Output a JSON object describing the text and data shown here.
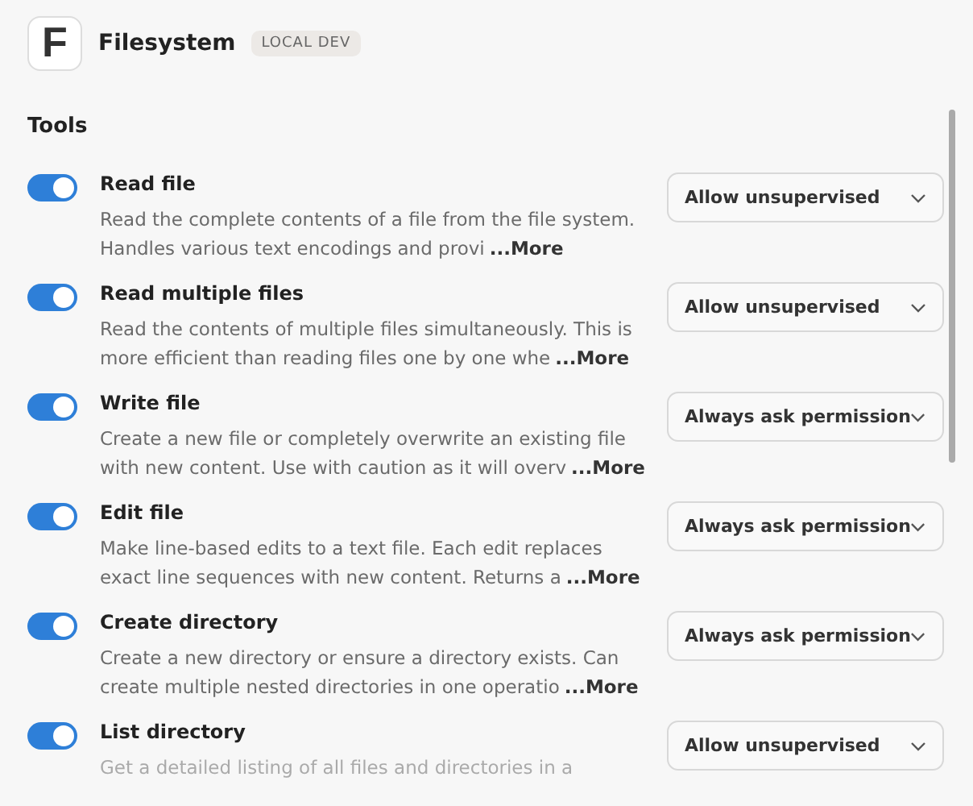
{
  "header": {
    "logo_letter": "F",
    "title": "Filesystem",
    "badge": "LOCAL DEV"
  },
  "section_title": "Tools",
  "tools": [
    {
      "name": "Read file",
      "on": true,
      "description": "Read the complete contents of a file from the file system. Handles various text encodings and provi",
      "more": "...More",
      "permission": "Allow unsupervised"
    },
    {
      "name": "Read multiple files",
      "on": true,
      "description": "Read the contents of multiple files simultaneously. This is more efficient than reading files one by one whe",
      "more": "...More",
      "permission": "Allow unsupervised"
    },
    {
      "name": "Write file",
      "on": true,
      "description": "Create a new file or completely overwrite an existing file with new content. Use with caution as it will overv",
      "more": "...More",
      "permission": "Always ask permission"
    },
    {
      "name": "Edit file",
      "on": true,
      "description": "Make line-based edits to a text file. Each edit replaces exact line sequences with new content. Returns a",
      "more": "...More",
      "permission": "Always ask permission"
    },
    {
      "name": "Create directory",
      "on": true,
      "description": "Create a new directory or ensure a directory exists. Can create multiple nested directories in one operatio",
      "more": "...More",
      "permission": "Always ask permission"
    },
    {
      "name": "List directory",
      "on": true,
      "description": "Get a detailed listing of all files and directories in a",
      "permission": "Allow unsupervised"
    }
  ]
}
